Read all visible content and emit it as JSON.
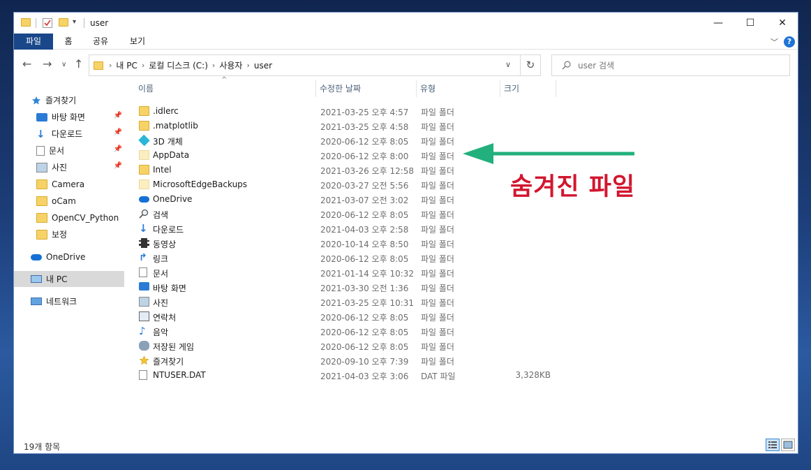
{
  "window": {
    "title": "user",
    "controls": {
      "minimize": "—",
      "maximize": "☐",
      "close": "✕"
    }
  },
  "ribbon": {
    "tabs": [
      "파일",
      "홈",
      "공유",
      "보기"
    ],
    "help": "?"
  },
  "address": {
    "segments": [
      "내 PC",
      "로컬 디스크 (C:)",
      "사용자",
      "user"
    ]
  },
  "search": {
    "placeholder": "user 검색"
  },
  "nav": {
    "quick_access": "즐겨찾기",
    "pinned": [
      {
        "label": "바탕 화면",
        "icon": "desktop-icon",
        "pinned": true
      },
      {
        "label": "다운로드",
        "icon": "download-icon",
        "pinned": true
      },
      {
        "label": "문서",
        "icon": "document-icon",
        "pinned": true
      },
      {
        "label": "사진",
        "icon": "picture-icon",
        "pinned": true
      },
      {
        "label": "Camera",
        "icon": "folder-icon",
        "pinned": false
      },
      {
        "label": "oCam",
        "icon": "folder-icon",
        "pinned": false
      },
      {
        "label": "OpenCV_Python",
        "icon": "folder-icon",
        "pinned": false
      },
      {
        "label": "보정",
        "icon": "folder-icon",
        "pinned": false
      }
    ],
    "onedrive": "OneDrive",
    "this_pc": "내 PC",
    "network": "네트워크"
  },
  "columns": {
    "name": "이름",
    "date": "수정한 날짜",
    "type": "유형",
    "size": "크기"
  },
  "files": [
    {
      "name": ".idlerc",
      "date": "2021-03-25 오후 4:57",
      "type": "파일 폴더",
      "size": "",
      "icon": "folder-icon"
    },
    {
      "name": ".matplotlib",
      "date": "2021-03-25 오후 4:58",
      "type": "파일 폴더",
      "size": "",
      "icon": "folder-icon"
    },
    {
      "name": "3D 개체",
      "date": "2020-06-12 오후 8:05",
      "type": "파일 폴더",
      "size": "",
      "icon": "3d-objects-icon"
    },
    {
      "name": "AppData",
      "date": "2020-06-12 오후 8:00",
      "type": "파일 폴더",
      "size": "",
      "icon": "hidden-folder-icon"
    },
    {
      "name": "Intel",
      "date": "2021-03-26 오후 12:58",
      "type": "파일 폴더",
      "size": "",
      "icon": "folder-icon"
    },
    {
      "name": "MicrosoftEdgeBackups",
      "date": "2020-03-27 오전 5:56",
      "type": "파일 폴더",
      "size": "",
      "icon": "hidden-folder-icon"
    },
    {
      "name": "OneDrive",
      "date": "2021-03-07 오전 3:02",
      "type": "파일 폴더",
      "size": "",
      "icon": "onedrive-icon"
    },
    {
      "name": "검색",
      "date": "2020-06-12 오후 8:05",
      "type": "파일 폴더",
      "size": "",
      "icon": "search-icon"
    },
    {
      "name": "다운로드",
      "date": "2021-04-03 오후 2:58",
      "type": "파일 폴더",
      "size": "",
      "icon": "download-icon"
    },
    {
      "name": "동영상",
      "date": "2020-10-14 오후 8:50",
      "type": "파일 폴더",
      "size": "",
      "icon": "video-icon"
    },
    {
      "name": "링크",
      "date": "2020-06-12 오후 8:05",
      "type": "파일 폴더",
      "size": "",
      "icon": "link-icon"
    },
    {
      "name": "문서",
      "date": "2021-01-14 오후 10:32",
      "type": "파일 폴더",
      "size": "",
      "icon": "document-icon"
    },
    {
      "name": "바탕 화면",
      "date": "2021-03-30 오전 1:36",
      "type": "파일 폴더",
      "size": "",
      "icon": "desktop-icon"
    },
    {
      "name": "사진",
      "date": "2021-03-25 오후 10:31",
      "type": "파일 폴더",
      "size": "",
      "icon": "picture-icon"
    },
    {
      "name": "연락처",
      "date": "2020-06-12 오후 8:05",
      "type": "파일 폴더",
      "size": "",
      "icon": "contacts-icon"
    },
    {
      "name": "음악",
      "date": "2020-06-12 오후 8:05",
      "type": "파일 폴더",
      "size": "",
      "icon": "music-icon"
    },
    {
      "name": "저장된 게임",
      "date": "2020-06-12 오후 8:05",
      "type": "파일 폴더",
      "size": "",
      "icon": "saved-games-icon"
    },
    {
      "name": "즐겨찾기",
      "date": "2020-09-10 오후 7:39",
      "type": "파일 폴더",
      "size": "",
      "icon": "favorites-icon"
    },
    {
      "name": "NTUSER.DAT",
      "date": "2021-04-03 오후 3:06",
      "type": "DAT 파일",
      "size": "3,328KB",
      "icon": "file-icon"
    }
  ],
  "status": {
    "count": "19개 항목"
  },
  "annotation": {
    "text": "숨겨진 파일",
    "color": "#d2162f",
    "arrow_color": "#22b07d"
  }
}
